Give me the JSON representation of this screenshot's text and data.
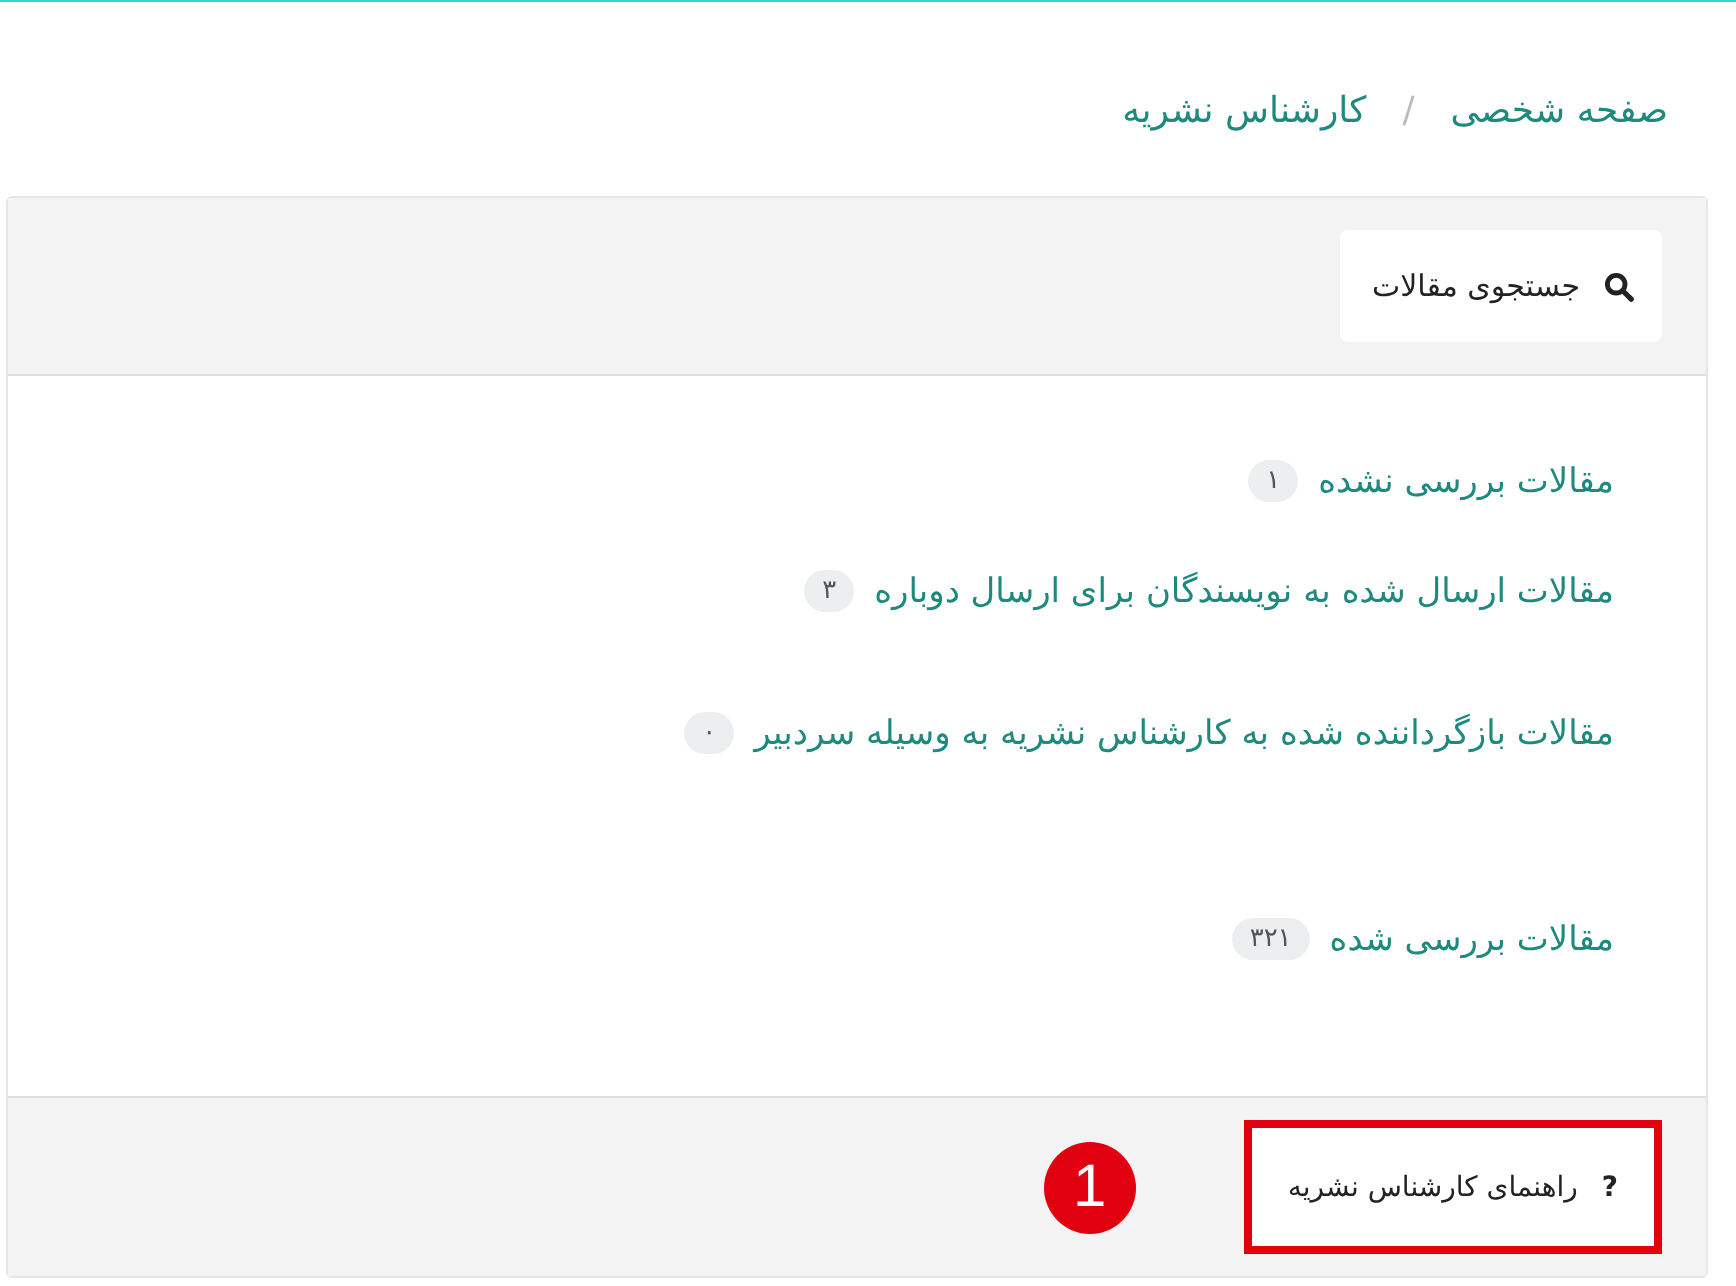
{
  "breadcrumb": [
    "صفحه شخصی",
    "/",
    "کارشناس نشریه"
  ],
  "search_button": {
    "label": "جستجوی مقالات"
  },
  "article_links": [
    {
      "label": "مقالات بررسی نشده",
      "count": "۱"
    },
    {
      "label": "مقالات ارسال شده به نویسندگان برای ارسال دوباره",
      "count": "۳"
    },
    {
      "label": "مقالات بازگرداننده شده به کارشناس نشریه به وسیله سردبیر",
      "count": "۰"
    },
    {
      "label": "مقالات بررسی شده",
      "count": "۳۲۱"
    }
  ],
  "help_button": {
    "icon_glyph": "?",
    "label": "راهنمای کارشناس نشریه",
    "highlighted": true
  },
  "callout": {
    "label": "1"
  }
}
